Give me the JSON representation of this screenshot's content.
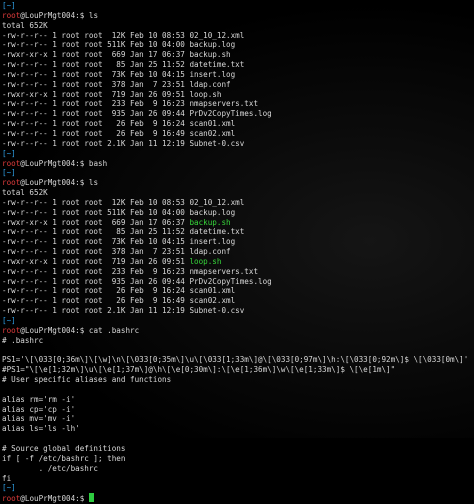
{
  "colors": {
    "background": "#000000",
    "text": "#d8d8d8",
    "bracket": "#2ea0e6",
    "user": "#e03c3c",
    "host": "#d8d8d8",
    "path": "#2ea0e6",
    "executable": "#36d63a",
    "comment": "#d8d8d8"
  },
  "prompt": {
    "tilde_line": "[~]",
    "user": "root",
    "host": "@LouPrMgt004",
    "sep": ":",
    "path": "$"
  },
  "lines": [
    {
      "segs": [
        [
          "[~]",
          "bracket"
        ]
      ]
    },
    {
      "segs": [
        [
          "root",
          "user"
        ],
        [
          "@LouPrMgt004:$ ls",
          "text"
        ]
      ]
    },
    {
      "segs": [
        [
          "total 652K",
          "text"
        ]
      ]
    },
    {
      "segs": [
        [
          "-rw-r--r-- 1 root root  12K Feb 10 08:53 02_10_12.xml",
          "text"
        ]
      ]
    },
    {
      "segs": [
        [
          "-rw-r--r-- 1 root root 511K Feb 10 04:00 backup.log",
          "text"
        ]
      ]
    },
    {
      "segs": [
        [
          "-rwxr-xr-x 1 root root  669 Jan 17 06:37 backup.sh",
          "text"
        ]
      ]
    },
    {
      "segs": [
        [
          "-rw-r--r-- 1 root root   85 Jan 25 11:52 datetime.txt",
          "text"
        ]
      ]
    },
    {
      "segs": [
        [
          "-rw-r--r-- 1 root root  73K Feb 10 04:15 insert.log",
          "text"
        ]
      ]
    },
    {
      "segs": [
        [
          "-rw-r--r-- 1 root root  378 Jan  7 23:51 ldap.conf",
          "text"
        ]
      ]
    },
    {
      "segs": [
        [
          "-rwxr-xr-x 1 root root  719 Jan 26 09:51 loop.sh",
          "text"
        ]
      ]
    },
    {
      "segs": [
        [
          "-rw-r--r-- 1 root root  233 Feb  9 16:23 nmapservers.txt",
          "text"
        ]
      ]
    },
    {
      "segs": [
        [
          "-rw-r--r-- 1 root root  935 Jan 26 09:44 PrDv2CopyTimes.log",
          "text"
        ]
      ]
    },
    {
      "segs": [
        [
          "-rw-r--r-- 1 root root   26 Feb  9 16:24 scan01.xml",
          "text"
        ]
      ]
    },
    {
      "segs": [
        [
          "-rw-r--r-- 1 root root   26 Feb  9 16:49 scan02.xml",
          "text"
        ]
      ]
    },
    {
      "segs": [
        [
          "-rw-r--r-- 1 root root 2.1K Jan 11 12:19 Subnet-0.csv",
          "text"
        ]
      ]
    },
    {
      "segs": [
        [
          "[~]",
          "bracket"
        ]
      ]
    },
    {
      "segs": [
        [
          "root",
          "user"
        ],
        [
          "@LouPrMgt004:$ bash",
          "text"
        ]
      ]
    },
    {
      "segs": [
        [
          "[~]",
          "bracket"
        ]
      ]
    },
    {
      "segs": [
        [
          "root",
          "user"
        ],
        [
          "@LouPrMgt004:$ ls",
          "text"
        ]
      ]
    },
    {
      "segs": [
        [
          "total 652K",
          "text"
        ]
      ]
    },
    {
      "segs": [
        [
          "-rw-r--r-- 1 root root  12K Feb 10 08:53 02_10_12.xml",
          "text"
        ]
      ]
    },
    {
      "segs": [
        [
          "-rw-r--r-- 1 root root 511K Feb 10 04:00 backup.log",
          "text"
        ]
      ]
    },
    {
      "segs": [
        [
          "-rwxr-xr-x 1 root root  669 Jan 17 06:37 ",
          "text"
        ],
        [
          "backup.sh",
          "executable"
        ]
      ]
    },
    {
      "segs": [
        [
          "-rw-r--r-- 1 root root   85 Jan 25 11:52 datetime.txt",
          "text"
        ]
      ]
    },
    {
      "segs": [
        [
          "-rw-r--r-- 1 root root  73K Feb 10 04:15 insert.log",
          "text"
        ]
      ]
    },
    {
      "segs": [
        [
          "-rw-r--r-- 1 root root  378 Jan  7 23:51 ldap.conf",
          "text"
        ]
      ]
    },
    {
      "segs": [
        [
          "-rwxr-xr-x 1 root root  719 Jan 26 09:51 ",
          "text"
        ],
        [
          "loop.sh",
          "executable"
        ]
      ]
    },
    {
      "segs": [
        [
          "-rw-r--r-- 1 root root  233 Feb  9 16:23 nmapservers.txt",
          "text"
        ]
      ]
    },
    {
      "segs": [
        [
          "-rw-r--r-- 1 root root  935 Jan 26 09:44 PrDv2CopyTimes.log",
          "text"
        ]
      ]
    },
    {
      "segs": [
        [
          "-rw-r--r-- 1 root root   26 Feb  9 16:24 scan01.xml",
          "text"
        ]
      ]
    },
    {
      "segs": [
        [
          "-rw-r--r-- 1 root root   26 Feb  9 16:49 scan02.xml",
          "text"
        ]
      ]
    },
    {
      "segs": [
        [
          "-rw-r--r-- 1 root root 2.1K Jan 11 12:19 Subnet-0.csv",
          "text"
        ]
      ]
    },
    {
      "segs": [
        [
          "[~]",
          "bracket"
        ]
      ]
    },
    {
      "segs": [
        [
          "root",
          "user"
        ],
        [
          "@LouPrMgt004:$ cat .bashrc",
          "text"
        ]
      ]
    },
    {
      "segs": [
        [
          "# .bashrc",
          "text"
        ]
      ]
    },
    {
      "segs": [
        [
          "",
          "text"
        ]
      ]
    },
    {
      "segs": [
        [
          "PS1='\\[\\033[0;36m\\]\\[\\w]\\n\\[\\033[0;35m\\]\\u\\[\\033[1;33m\\]@\\[\\033[0;97m\\]\\h:\\[\\033[0;92m\\]$ \\[\\033[0m\\]'",
          "text"
        ]
      ]
    },
    {
      "segs": [
        [
          "#PS1=\"\\[\\e[1;32m\\]\\u\\[\\e[1;37m\\]@\\h\\[\\e[0;30m\\]:\\[\\e[1;36m\\]\\w\\[\\e[1;33m\\]$ \\[\\e[1m\\]\"",
          "text"
        ]
      ]
    },
    {
      "segs": [
        [
          "# User specific aliases and functions",
          "text"
        ]
      ]
    },
    {
      "segs": [
        [
          "",
          "text"
        ]
      ]
    },
    {
      "segs": [
        [
          "alias rm='rm -i'",
          "text"
        ]
      ]
    },
    {
      "segs": [
        [
          "alias cp='cp -i'",
          "text"
        ]
      ]
    },
    {
      "segs": [
        [
          "alias mv='mv -i'",
          "text"
        ]
      ]
    },
    {
      "segs": [
        [
          "alias ls='ls -lh'",
          "text"
        ]
      ]
    },
    {
      "segs": [
        [
          "",
          "text"
        ]
      ]
    },
    {
      "segs": [
        [
          "# Source global definitions",
          "text"
        ]
      ]
    },
    {
      "segs": [
        [
          "if [ -f /etc/bashrc ]; then",
          "text"
        ]
      ]
    },
    {
      "segs": [
        [
          "        . /etc/bashrc",
          "text"
        ]
      ]
    },
    {
      "segs": [
        [
          "fi",
          "text"
        ]
      ]
    },
    {
      "segs": [
        [
          "[~]",
          "bracket"
        ]
      ]
    },
    {
      "segs": [
        [
          "root",
          "user"
        ],
        [
          "@LouPrMgt004:$ ",
          "text"
        ]
      ],
      "cursor": true
    }
  ]
}
